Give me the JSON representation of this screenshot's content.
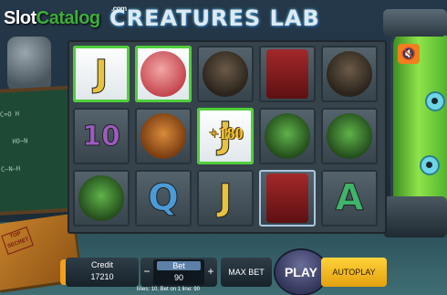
{
  "branding": {
    "site_logo_main": "Slot",
    "site_logo_accent": "Catalog",
    "site_logo_suffix": ".com"
  },
  "game": {
    "title": "CREATURES LAB"
  },
  "scene": {
    "stamp_text": "TOP SECRET"
  },
  "grid": {
    "rows": [
      [
        {
          "type": "letter",
          "text": "J",
          "style": "win"
        },
        {
          "type": "art",
          "name": "brain-symbol",
          "style": "win"
        },
        {
          "type": "art",
          "name": "owl-symbol"
        },
        {
          "type": "art",
          "name": "safe-symbol"
        },
        {
          "type": "art",
          "name": "owl-symbol"
        }
      ],
      [
        {
          "type": "letter",
          "text": "10"
        },
        {
          "type": "art",
          "name": "fox-symbol"
        },
        {
          "type": "letter",
          "text": "J",
          "style": "win",
          "win": "+180"
        },
        {
          "type": "art",
          "name": "frog-symbol"
        },
        {
          "type": "art",
          "name": "frog-symbol"
        }
      ],
      [
        {
          "type": "art",
          "name": "frog-symbol"
        },
        {
          "type": "letter",
          "text": "Q"
        },
        {
          "type": "letter",
          "text": "J"
        },
        {
          "type": "art",
          "name": "safe-symbol",
          "style": "sel"
        },
        {
          "type": "letter",
          "text": "A"
        }
      ]
    ]
  },
  "controls": {
    "credit_label": "Credit",
    "credit_value": "17210",
    "bet_label": "Bet",
    "bet_value": "90",
    "minus": "−",
    "plus": "+",
    "maxbet_label": "MAX BET",
    "play_label": "PLAY",
    "autoplay_label": "AUTOPLAY",
    "mute_icon": "speaker-mute-icon"
  },
  "status": {
    "info": "lines: 10,   Bet on 1 line: 90"
  },
  "colors": {
    "win_border": "#4fce3c",
    "letter_J": "#e8c341",
    "letter_10": "#9c5cc0",
    "letter_Q": "#4a9bd8",
    "letter_A": "#3fb46a",
    "win_amount": "#f2c43a"
  }
}
